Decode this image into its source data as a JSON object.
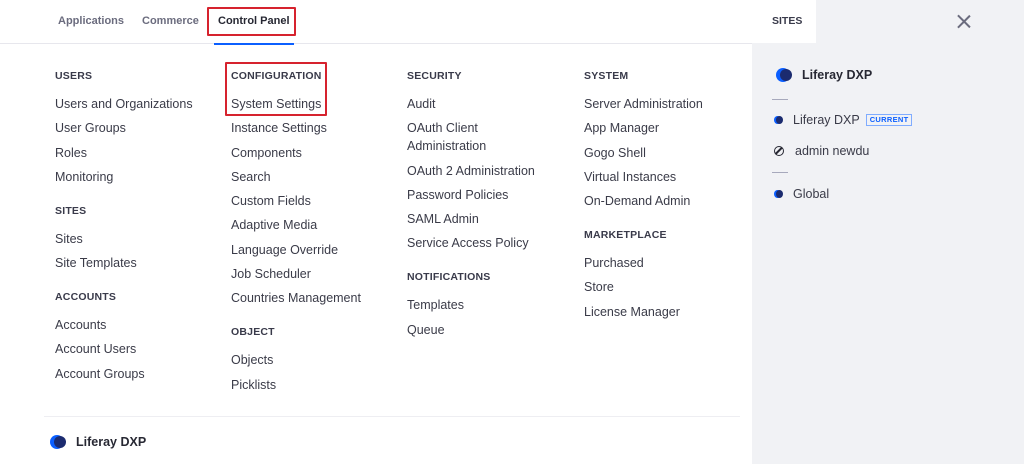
{
  "tabs": [
    {
      "label": "Applications"
    },
    {
      "label": "Commerce"
    },
    {
      "label": "Control Panel"
    }
  ],
  "columns": [
    {
      "sections": [
        {
          "title": "USERS",
          "items": [
            "Users and Organizations",
            "User Groups",
            "Roles",
            "Monitoring"
          ]
        },
        {
          "title": "SITES",
          "items": [
            "Sites",
            "Site Templates"
          ]
        },
        {
          "title": "ACCOUNTS",
          "items": [
            "Accounts",
            "Account Users",
            "Account Groups"
          ]
        }
      ]
    },
    {
      "sections": [
        {
          "title": "CONFIGURATION",
          "items": [
            "System Settings",
            "Instance Settings",
            "Components",
            "Search",
            "Custom Fields",
            "Adaptive Media",
            "Language Override",
            "Job Scheduler",
            "Countries Management"
          ]
        },
        {
          "title": "OBJECT",
          "items": [
            "Objects",
            "Picklists"
          ]
        }
      ]
    },
    {
      "sections": [
        {
          "title": "SECURITY",
          "items": [
            "Audit",
            "OAuth Client Administration",
            "OAuth 2 Administration",
            "Password Policies",
            "SAML Admin",
            "Service Access Policy"
          ]
        },
        {
          "title": "NOTIFICATIONS",
          "items": [
            "Templates",
            "Queue"
          ]
        }
      ]
    },
    {
      "sections": [
        {
          "title": "SYSTEM",
          "items": [
            "Server Administration",
            "App Manager",
            "Gogo Shell",
            "Virtual Instances",
            "On-Demand Admin"
          ]
        },
        {
          "title": "MARKETPLACE",
          "items": [
            "Purchased",
            "Store",
            "License Manager"
          ]
        }
      ]
    }
  ],
  "footer": {
    "label": "Liferay DXP",
    "icon": "liferay-logo-icon"
  },
  "panel": {
    "tab_label": "SITES",
    "main_site": "Liferay DXP",
    "items": [
      {
        "label": "Liferay DXP",
        "badge": "CURRENT",
        "icon": "site-dot-icon"
      },
      {
        "label": "admin newdu",
        "icon": "user-personal-site-icon"
      },
      {
        "label": "Global",
        "icon": "site-dot-icon"
      }
    ]
  },
  "colors": {
    "accent": "#0b5fff",
    "highlight": "#d6232e",
    "panel_bg": "#f1f2f5"
  }
}
